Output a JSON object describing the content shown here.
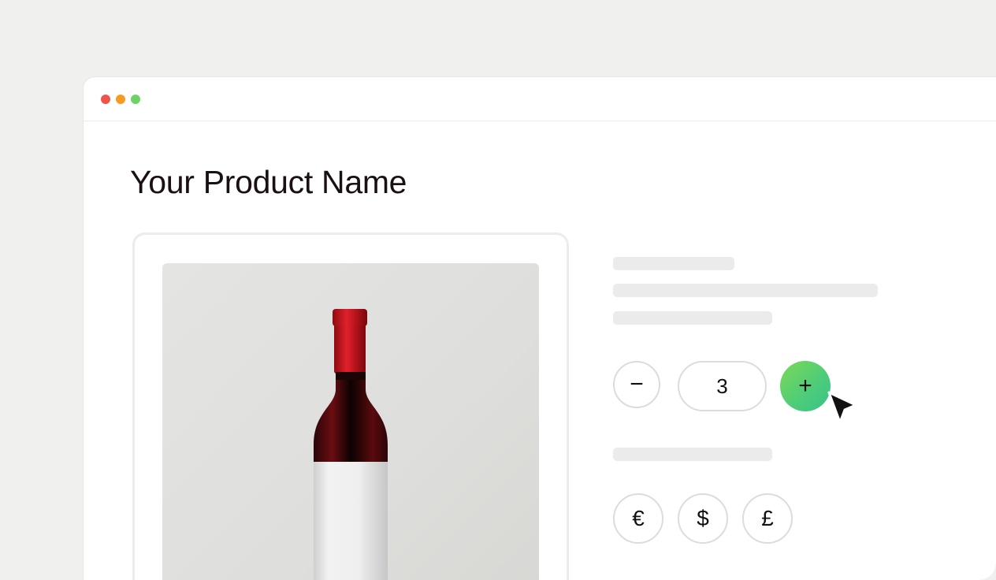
{
  "product": {
    "title": "Your Product Name"
  },
  "quantity": {
    "minus_label": "−",
    "value": "3",
    "plus_label": "+"
  },
  "currencies": [
    {
      "symbol": "€"
    },
    {
      "symbol": "$"
    },
    {
      "symbol": "£"
    }
  ],
  "colors": {
    "accent_gradient_start": "#7dd856",
    "accent_gradient_end": "#39c28a",
    "window_dot_red": "#f0534b",
    "window_dot_orange": "#f79a1e",
    "window_dot_green": "#6fd265"
  },
  "icons": {
    "cursor": "pointer-cursor-icon",
    "product_image": "wine-bottle-icon"
  }
}
